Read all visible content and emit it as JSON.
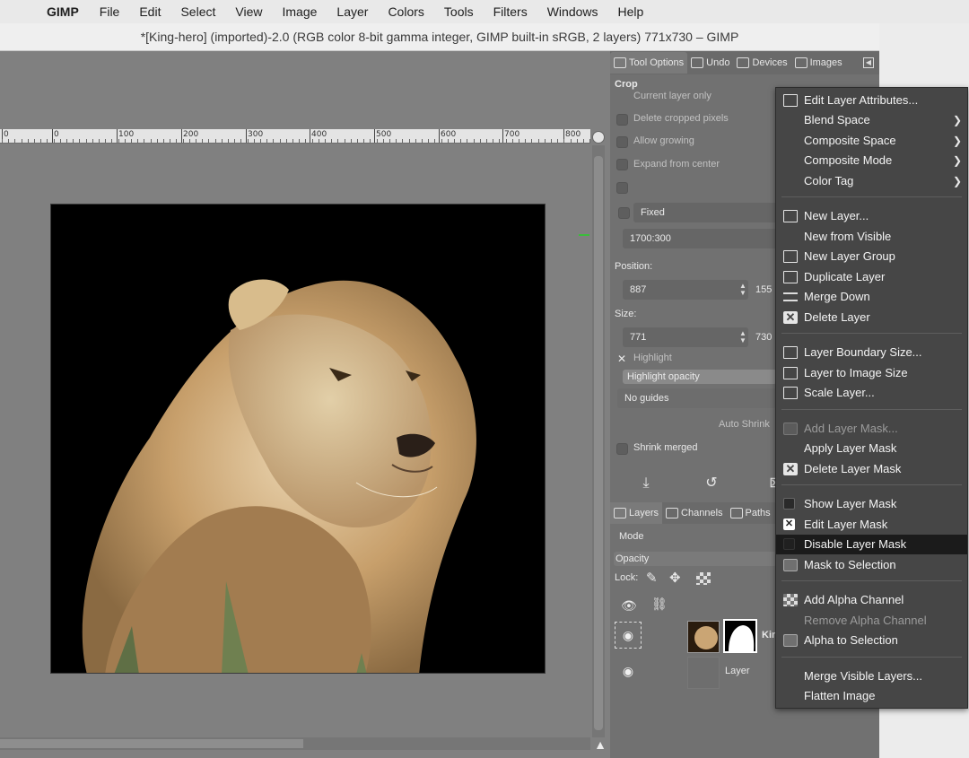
{
  "menubar": {
    "app": "GIMP",
    "items": [
      "File",
      "Edit",
      "Select",
      "View",
      "Image",
      "Layer",
      "Colors",
      "Tools",
      "Filters",
      "Windows",
      "Help"
    ]
  },
  "window": {
    "title": "*[King-hero] (imported)-2.0 (RGB color 8-bit gamma integer, GIMP built-in sRGB, 2 layers) 771x730 – GIMP"
  },
  "ruler": {
    "labels": [
      "0",
      "0",
      "100",
      "200",
      "300",
      "400",
      "500",
      "600",
      "700",
      "800"
    ]
  },
  "dock": {
    "tabs": [
      {
        "label": "Tool Options",
        "icon": "tool-options-icon"
      },
      {
        "label": "Undo",
        "icon": "undo-icon"
      },
      {
        "label": "Devices",
        "icon": "devices-icon"
      },
      {
        "label": "Images",
        "icon": "images-icon"
      }
    ],
    "tool_name": "Crop",
    "options": {
      "current_layer_only": "Current layer only",
      "delete_cropped": "Delete cropped pixels",
      "allow_growing": "Allow growing",
      "expand_from_center": "Expand from center",
      "fixed": "Fixed",
      "ratio": "1700:300",
      "position_label": "Position:",
      "position_x": "887",
      "position_y": "155",
      "size_label": "Size:",
      "size_w": "771",
      "size_h": "730",
      "highlight": "Highlight",
      "highlight_opacity": "Highlight opacity",
      "guides": "No guides",
      "auto_shrink": "Auto Shrink",
      "shrink_merged": "Shrink merged"
    },
    "layers_tabs": [
      {
        "label": "Layers",
        "icon": "layers-icon"
      },
      {
        "label": "Channels",
        "icon": "channels-icon"
      },
      {
        "label": "Paths",
        "icon": "paths-icon"
      }
    ],
    "layers": {
      "mode_label": "Mode",
      "opacity_label": "Opacity",
      "lock_label": "Lock:",
      "rows": [
        {
          "name": "Kir"
        },
        {
          "name": "Layer"
        }
      ]
    }
  },
  "context_menu": {
    "items": [
      {
        "label": "Edit Layer Attributes...",
        "icon": "edit-layer-attributes-icon",
        "enabled": true
      },
      {
        "label": "Blend Space",
        "submenu": true,
        "enabled": true
      },
      {
        "label": "Composite Space",
        "submenu": true,
        "enabled": true
      },
      {
        "label": "Composite Mode",
        "submenu": true,
        "enabled": true
      },
      {
        "label": "Color Tag",
        "submenu": true,
        "enabled": true
      },
      {
        "label": "New Layer...",
        "icon": "new-layer-icon",
        "enabled": true
      },
      {
        "label": "New from Visible",
        "enabled": true
      },
      {
        "label": "New Layer Group",
        "icon": "new-layer-group-icon",
        "enabled": true
      },
      {
        "label": "Duplicate Layer",
        "icon": "duplicate-layer-icon",
        "enabled": true
      },
      {
        "label": "Merge Down",
        "icon": "merge-down-icon",
        "enabled": true
      },
      {
        "label": "Delete Layer",
        "icon": "delete-layer-icon",
        "enabled": true
      },
      {
        "label": "Layer Boundary Size...",
        "icon": "layer-boundary-size-icon",
        "enabled": true
      },
      {
        "label": "Layer to Image Size",
        "icon": "layer-to-image-size-icon",
        "enabled": true
      },
      {
        "label": "Scale Layer...",
        "icon": "scale-layer-icon",
        "enabled": true
      },
      {
        "label": "Add Layer Mask...",
        "icon": "add-layer-mask-icon",
        "enabled": false
      },
      {
        "label": "Apply Layer Mask",
        "enabled": true
      },
      {
        "label": "Delete Layer Mask",
        "icon": "delete-layer-mask-icon",
        "enabled": true
      },
      {
        "label": "Show Layer Mask",
        "icon": "show-layer-mask-checkbox-icon",
        "enabled": true
      },
      {
        "label": "Edit Layer Mask",
        "icon": "edit-layer-mask-checkbox-icon",
        "enabled": true,
        "checked": true
      },
      {
        "label": "Disable Layer Mask",
        "icon": "disable-layer-mask-checkbox-icon",
        "enabled": true,
        "highlighted": true
      },
      {
        "label": "Mask to Selection",
        "icon": "mask-to-selection-icon",
        "enabled": true
      },
      {
        "label": "Add Alpha Channel",
        "icon": "add-alpha-channel-icon",
        "enabled": true
      },
      {
        "label": "Remove Alpha Channel",
        "enabled": false
      },
      {
        "label": "Alpha to Selection",
        "icon": "alpha-to-selection-icon",
        "enabled": true
      },
      {
        "label": "Merge Visible Layers...",
        "enabled": true
      },
      {
        "label": "Flatten Image",
        "enabled": true
      }
    ]
  },
  "colors": {
    "menu_bg": "#464646",
    "menu_highlight": "#1b1b1b",
    "canvas_bg": "#808080",
    "dock_bg": "#717171"
  }
}
